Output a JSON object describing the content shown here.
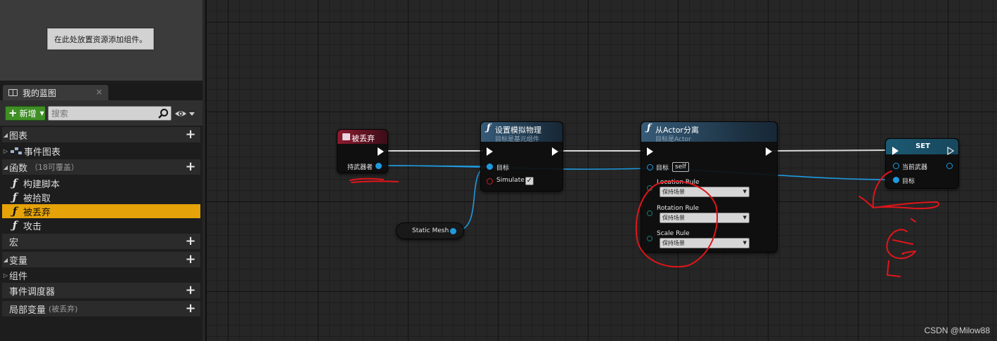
{
  "left_panel": {
    "drop_hint": "在此处放置资源添加组件。",
    "tab": {
      "label": "我的蓝图",
      "close": "×"
    },
    "toolbar": {
      "add_label": "新增",
      "search_placeholder": "搜索"
    },
    "tree": {
      "graphs": "图表",
      "event_graph": "事件图表",
      "functions": "函数",
      "functions_sub": "（18可覆盖）",
      "function_items": [
        "构建脚本",
        "被拾取",
        "被丢弃",
        "攻击"
      ],
      "macros": "宏",
      "variables": "变量",
      "components": "组件",
      "dispatchers": "事件调度器",
      "local_vars": "局部变量",
      "local_vars_sub": "(被丢弃)"
    }
  },
  "graph": {
    "node_throw": {
      "title": "被丢弃",
      "pin_holder": "持武器者"
    },
    "node_sim": {
      "title": "设置模拟物理",
      "subtitle": "目标是基元组件",
      "pin_target": "目标",
      "pin_simulate": "Simulate",
      "simulate_checked": "✓"
    },
    "node_detach": {
      "title": "从Actor分离",
      "subtitle": "目标是Actor",
      "pin_target": "目标",
      "self_value": "self",
      "location_rule": "Location Rule",
      "rotation_rule": "Rotation Rule",
      "scale_rule": "Scale Rule",
      "location_value": "保持场景",
      "rotation_value": "保持场景",
      "scale_value": "保持场景"
    },
    "node_set": {
      "title": "SET",
      "pin_current_weapon": "当前武器",
      "pin_target": "目标"
    },
    "node_mesh": {
      "label": "Static Mesh"
    }
  },
  "colors": {
    "selected_row": "#e5a309",
    "data_wire": "#1f9ae0",
    "event_header": "#8e1b2e",
    "function_header": "#365b78",
    "ink": "#e0151b"
  },
  "watermark": "CSDN @Milow88"
}
